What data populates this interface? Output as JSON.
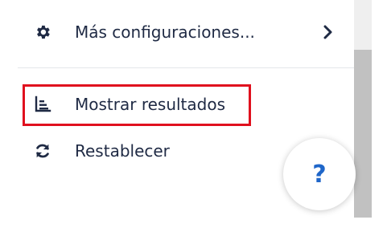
{
  "menu": {
    "items": [
      {
        "label": "Más configuraciones...",
        "icon": "gear-icon",
        "has_submenu": true
      },
      {
        "label": "Mostrar resultados",
        "icon": "bar-chart-list-icon",
        "highlighted": true
      },
      {
        "label": "Restablecer",
        "icon": "reset-arrows-icon"
      }
    ]
  },
  "help": {
    "label": "?"
  },
  "colors": {
    "text": "#1f2a44",
    "highlight_border": "#e0101e",
    "help_accent": "#1f66c9",
    "scrollbar_thumb": "#c1c1c1"
  }
}
